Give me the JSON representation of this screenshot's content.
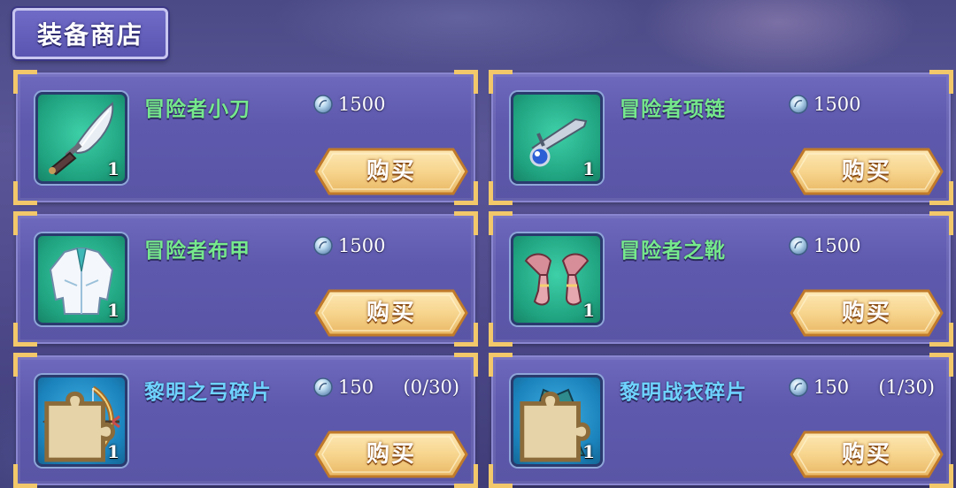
{
  "header": {
    "title": "装备商店"
  },
  "colors": {
    "name_normal": "#76e98c",
    "name_fragment": "#6fd4ff",
    "button": "#f7d58e",
    "frame_gold": "#f2c86a"
  },
  "items": [
    {
      "name": "冒险者小刀",
      "price": "1500",
      "qty": "1",
      "buy_label": "购买",
      "icon": "dagger-icon",
      "fragment": false
    },
    {
      "name": "冒险者项链",
      "price": "1500",
      "qty": "1",
      "buy_label": "购买",
      "icon": "necklace-icon",
      "fragment": false
    },
    {
      "name": "冒险者布甲",
      "price": "1500",
      "qty": "1",
      "buy_label": "购买",
      "icon": "cloth-armor-icon",
      "fragment": false
    },
    {
      "name": "冒险者之靴",
      "price": "1500",
      "qty": "1",
      "buy_label": "购买",
      "icon": "boots-icon",
      "fragment": false
    },
    {
      "name": "黎明之弓碎片",
      "price": "150",
      "progress": "(0/30)",
      "qty": "1",
      "buy_label": "购买",
      "icon": "bow-icon",
      "fragment": true
    },
    {
      "name": "黎明战衣碎片",
      "price": "150",
      "progress": "(1/30)",
      "qty": "1",
      "buy_label": "购买",
      "icon": "battle-dress-icon",
      "fragment": true
    }
  ]
}
